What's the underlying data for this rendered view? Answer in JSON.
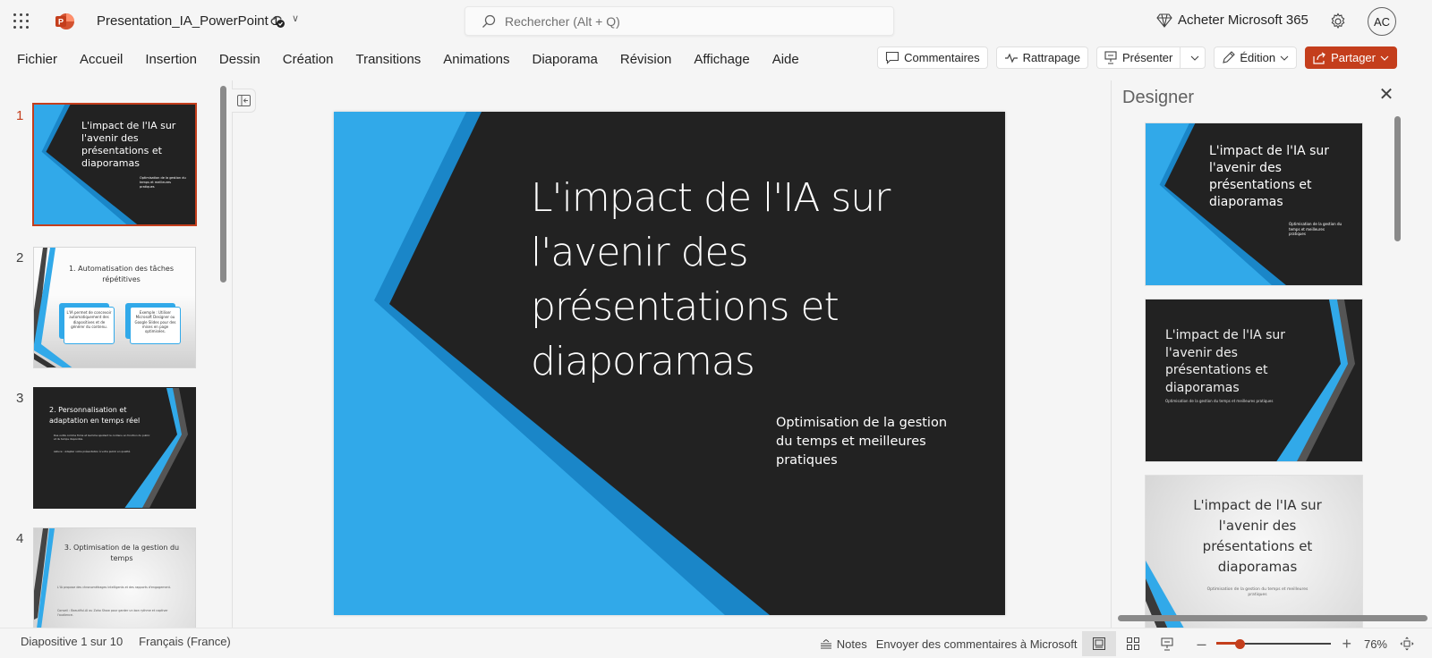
{
  "app": {
    "title": "Presentation_IA_PowerPoint 1",
    "brand_color": "#c43e1c",
    "search_placeholder": "Rechercher (Alt + Q)",
    "buy_label": "Acheter Microsoft 365",
    "avatar_initials": "AC"
  },
  "ribbon": {
    "tabs": [
      "Fichier",
      "Accueil",
      "Insertion",
      "Dessin",
      "Création",
      "Transitions",
      "Animations",
      "Diaporama",
      "Révision",
      "Affichage",
      "Aide"
    ],
    "comments_label": "Commentaires",
    "catchup_label": "Rattrapage",
    "present_label": "Présenter",
    "editing_label": "Édition",
    "share_label": "Partager"
  },
  "thumbnails": [
    {
      "number": "1",
      "active": true,
      "title": "L'impact de l'IA sur l'avenir des présentations et diaporamas",
      "subtitle": "Optimisation de la gestion du temps et meilleures pratiques"
    },
    {
      "number": "2",
      "active": false,
      "title": "1. Automatisation des tâches répétitives",
      "box1": "L'IA permet de concevoir automatiquement des diapositives et de générer du contenu.",
      "box2": "Exemple : Utiliser Microsoft Designer ou Google Slides pour des mises en page optimisées."
    },
    {
      "number": "3",
      "active": false,
      "title": "2. Personnalisation et adaptation en temps réel",
      "bullet1": "Des outils comme Tome et Gamma ajustent le contenu en fonction du public et du temps disponible.",
      "bullet2": "Astuce : Adapter votre présentation à votre public en qualité."
    },
    {
      "number": "4",
      "active": false,
      "title": "3. Optimisation de la gestion du temps",
      "bullet1": "L'IA propose des chronométrages intelligents et des rapports d'engagement.",
      "bullet2": "Conseil : Beautiful.AI ou Zoho Show pour garder un bon rythme et captiver l'audience."
    }
  ],
  "slide": {
    "title": "L'impact de l'IA sur l'avenir des présentations et diaporamas",
    "subtitle": "Optimisation de la gestion du temps et meilleures pratiques"
  },
  "designer": {
    "title": "Designer",
    "cards": [
      {
        "title": "L'impact de l'IA sur l'avenir des présentations et diaporamas",
        "subtitle": "Optimisation de la gestion du temps et meilleures pratiques"
      },
      {
        "title": "L'impact de l'IA sur l'avenir des présentations et diaporamas",
        "subtitle": "Optimisation de la gestion du temps et meilleures pratiques"
      },
      {
        "title": "L'impact de l'IA sur l'avenir des présentations et diaporamas",
        "subtitle": "Optimisation de la gestion du temps et meilleures pratiques"
      }
    ]
  },
  "status": {
    "slide_counter": "Diapositive 1 sur 10",
    "language": "Français (France)",
    "notes_label": "Notes",
    "feedback_label": "Envoyer des commentaires à Microsoft",
    "zoom_value": "76%",
    "zoom_fraction": 0.2
  }
}
